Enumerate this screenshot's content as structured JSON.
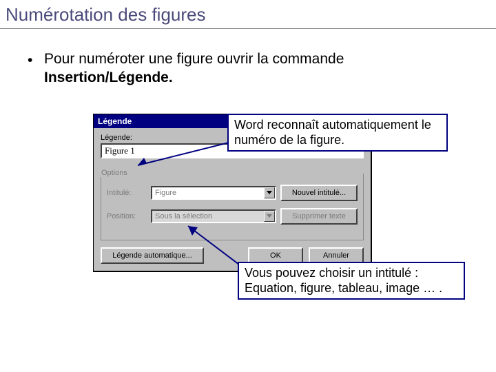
{
  "slide": {
    "title": "Numérotation des figures",
    "bullet_prefix": "Pour numéroter une figure ouvrir la commande ",
    "bullet_bold": "Insertion/Légende."
  },
  "dialog": {
    "title": "Légende",
    "label_legende": "Légende:",
    "input_value": "Figure 1",
    "group_label": "Options",
    "label_intitule": "Intitulé:",
    "combo_intitule_value": "Figure",
    "btn_nouvel": "Nouvel intitulé...",
    "label_position": "Position:",
    "combo_position_value": "Sous la sélection",
    "btn_supprimer": "Supprimer texte",
    "btn_auto": "Légende automatique...",
    "btn_ok": "OK",
    "btn_cancel": "Annuler"
  },
  "annot": {
    "a1": "Word reconnaît automatiquement le numéro de la figure.",
    "a2": "Vous pouvez choisir un intitulé : Equation, figure, tableau, image … ."
  }
}
